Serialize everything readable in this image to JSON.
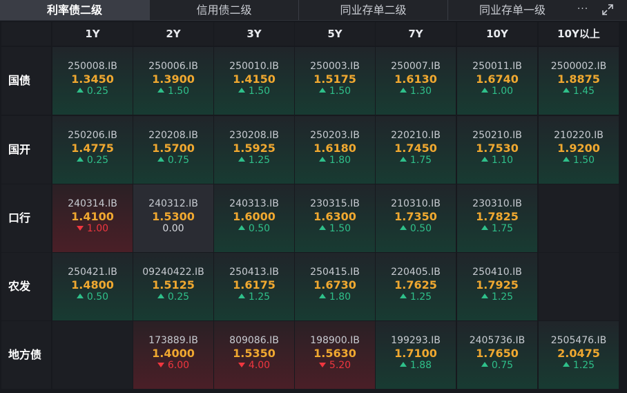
{
  "tabs": [
    {
      "label": "利率债二级",
      "active": true
    },
    {
      "label": "信用债二级",
      "active": false
    },
    {
      "label": "同业存单二级",
      "active": false
    },
    {
      "label": "同业存单一级",
      "active": false
    }
  ],
  "more_label": "···",
  "colors": {
    "up": "#2fc08a",
    "down": "#f0363f",
    "price": "#f0a830"
  },
  "columns": [
    "1Y",
    "2Y",
    "3Y",
    "5Y",
    "7Y",
    "10Y",
    "10Y以上"
  ],
  "rows": [
    {
      "name": "国债",
      "cells": [
        {
          "code": "250008.IB",
          "price": "1.3450",
          "change": "0.25",
          "dir": "up"
        },
        {
          "code": "250006.IB",
          "price": "1.3900",
          "change": "1.50",
          "dir": "up"
        },
        {
          "code": "250010.IB",
          "price": "1.4150",
          "change": "1.50",
          "dir": "up"
        },
        {
          "code": "250003.IB",
          "price": "1.5175",
          "change": "1.50",
          "dir": "up"
        },
        {
          "code": "250007.IB",
          "price": "1.6130",
          "change": "1.30",
          "dir": "up"
        },
        {
          "code": "250011.IB",
          "price": "1.6740",
          "change": "1.00",
          "dir": "up"
        },
        {
          "code": "2500002.IB",
          "price": "1.8875",
          "change": "1.45",
          "dir": "up"
        }
      ]
    },
    {
      "name": "国开",
      "cells": [
        {
          "code": "250206.IB",
          "price": "1.4775",
          "change": "0.25",
          "dir": "up"
        },
        {
          "code": "220208.IB",
          "price": "1.5700",
          "change": "0.75",
          "dir": "up"
        },
        {
          "code": "230208.IB",
          "price": "1.5925",
          "change": "1.25",
          "dir": "up"
        },
        {
          "code": "250203.IB",
          "price": "1.6180",
          "change": "1.80",
          "dir": "up"
        },
        {
          "code": "220210.IB",
          "price": "1.7450",
          "change": "1.75",
          "dir": "up"
        },
        {
          "code": "250210.IB",
          "price": "1.7530",
          "change": "1.10",
          "dir": "up"
        },
        {
          "code": "210220.IB",
          "price": "1.9200",
          "change": "1.50",
          "dir": "up"
        }
      ]
    },
    {
      "name": "口行",
      "cells": [
        {
          "code": "240314.IB",
          "price": "1.4100",
          "change": "1.00",
          "dir": "down"
        },
        {
          "code": "240312.IB",
          "price": "1.5300",
          "change": "0.00",
          "dir": "flat"
        },
        {
          "code": "240313.IB",
          "price": "1.6000",
          "change": "0.50",
          "dir": "up"
        },
        {
          "code": "230315.IB",
          "price": "1.6300",
          "change": "1.50",
          "dir": "up"
        },
        {
          "code": "210310.IB",
          "price": "1.7350",
          "change": "0.50",
          "dir": "up"
        },
        {
          "code": "230310.IB",
          "price": "1.7825",
          "change": "1.75",
          "dir": "up"
        },
        null
      ]
    },
    {
      "name": "农发",
      "cells": [
        {
          "code": "250421.IB",
          "price": "1.4800",
          "change": "0.50",
          "dir": "up"
        },
        {
          "code": "09240422.IB",
          "price": "1.5125",
          "change": "0.25",
          "dir": "up"
        },
        {
          "code": "250413.IB",
          "price": "1.6175",
          "change": "1.25",
          "dir": "up"
        },
        {
          "code": "250415.IB",
          "price": "1.6730",
          "change": "1.80",
          "dir": "up"
        },
        {
          "code": "220405.IB",
          "price": "1.7625",
          "change": "1.25",
          "dir": "up"
        },
        {
          "code": "250410.IB",
          "price": "1.7925",
          "change": "1.25",
          "dir": "up"
        },
        null
      ]
    },
    {
      "name": "地方债",
      "cells": [
        null,
        {
          "code": "173889.IB",
          "price": "1.4000",
          "change": "6.00",
          "dir": "down"
        },
        {
          "code": "809086.IB",
          "price": "1.5350",
          "change": "4.00",
          "dir": "down"
        },
        {
          "code": "198900.IB",
          "price": "1.5630",
          "change": "5.20",
          "dir": "down"
        },
        {
          "code": "199293.IB",
          "price": "1.7100",
          "change": "1.88",
          "dir": "up"
        },
        {
          "code": "2405736.IB",
          "price": "1.7650",
          "change": "0.75",
          "dir": "up"
        },
        {
          "code": "2505476.IB",
          "price": "2.0475",
          "change": "1.25",
          "dir": "up"
        }
      ]
    }
  ]
}
